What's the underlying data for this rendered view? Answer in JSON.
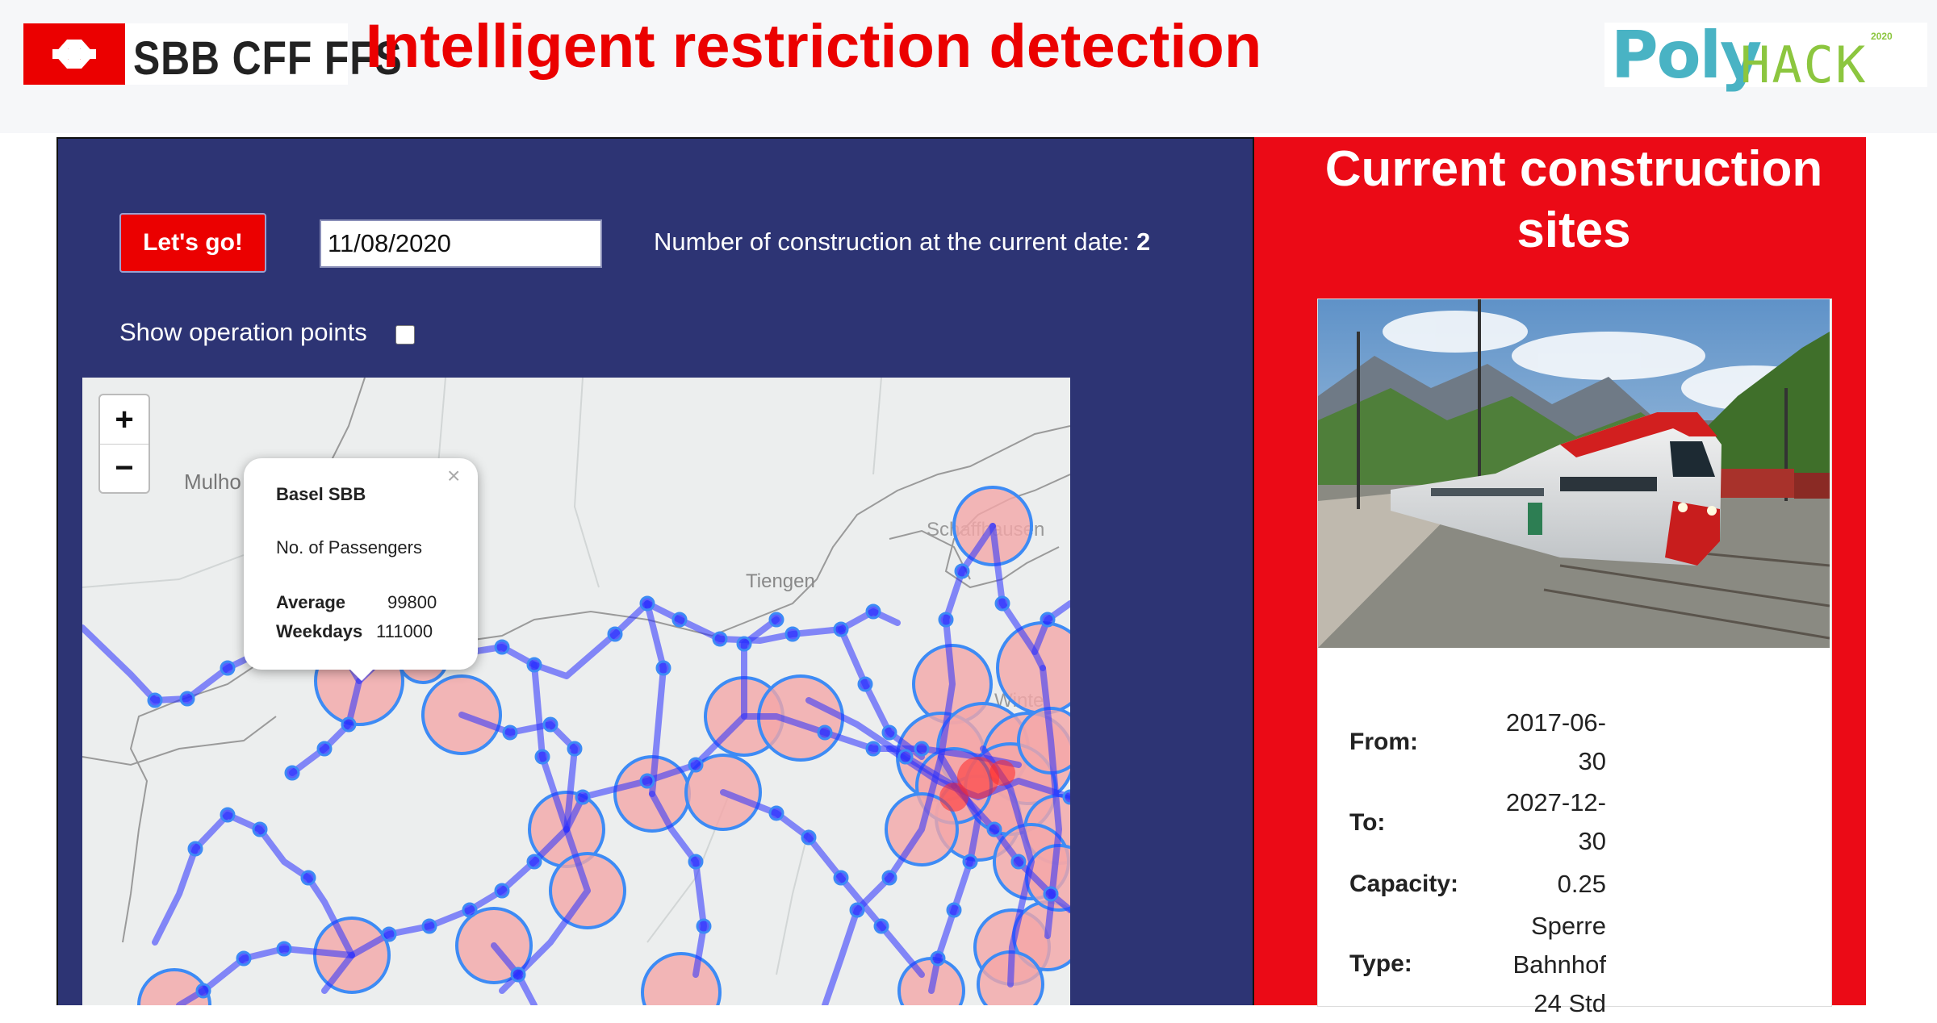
{
  "header": {
    "logo_text": "SBB CFF FFS",
    "title": "Intelligent restriction detection",
    "partner_logo_text": "PolyHACK",
    "partner_logo_year": "2020"
  },
  "controls": {
    "go_button_label": "Let's go!",
    "date_value": "11/08/2020",
    "count_label": "Number of construction at the current date:",
    "count_value": "2",
    "show_points_label": "Show operation points",
    "show_points_checked": false
  },
  "map": {
    "zoom_in": "+",
    "zoom_out": "−",
    "place_labels": [
      "Mulho",
      "Tiengen",
      "Schaffhausen",
      "Winte"
    ],
    "popup": {
      "close": "×",
      "title": "Basel SBB",
      "subtitle": "No. of Passengers",
      "rows": [
        {
          "label": "Average",
          "value": "99800"
        },
        {
          "label": "Weekdays",
          "value": "111000"
        }
      ]
    }
  },
  "sidebar": {
    "title_line1": "Current construction",
    "title_line2": "sites",
    "details": [
      {
        "label": "From:",
        "value_lines": [
          "2017-06-",
          "30"
        ]
      },
      {
        "label": "To:",
        "value_lines": [
          "2027-12-",
          "30"
        ]
      },
      {
        "label": "Capacity:",
        "value_lines": [
          "0.25"
        ]
      },
      {
        "label": "Type:",
        "value_lines": [
          "Sperre",
          "Bahnhof",
          "24 Std"
        ]
      }
    ]
  },
  "colors": {
    "brand_red": "#eb0000",
    "panel_blue": "#2d3474",
    "network_blue": "#1f26ff",
    "station_fill": "#f4a6a8",
    "station_ring": "#3d8bf5"
  }
}
